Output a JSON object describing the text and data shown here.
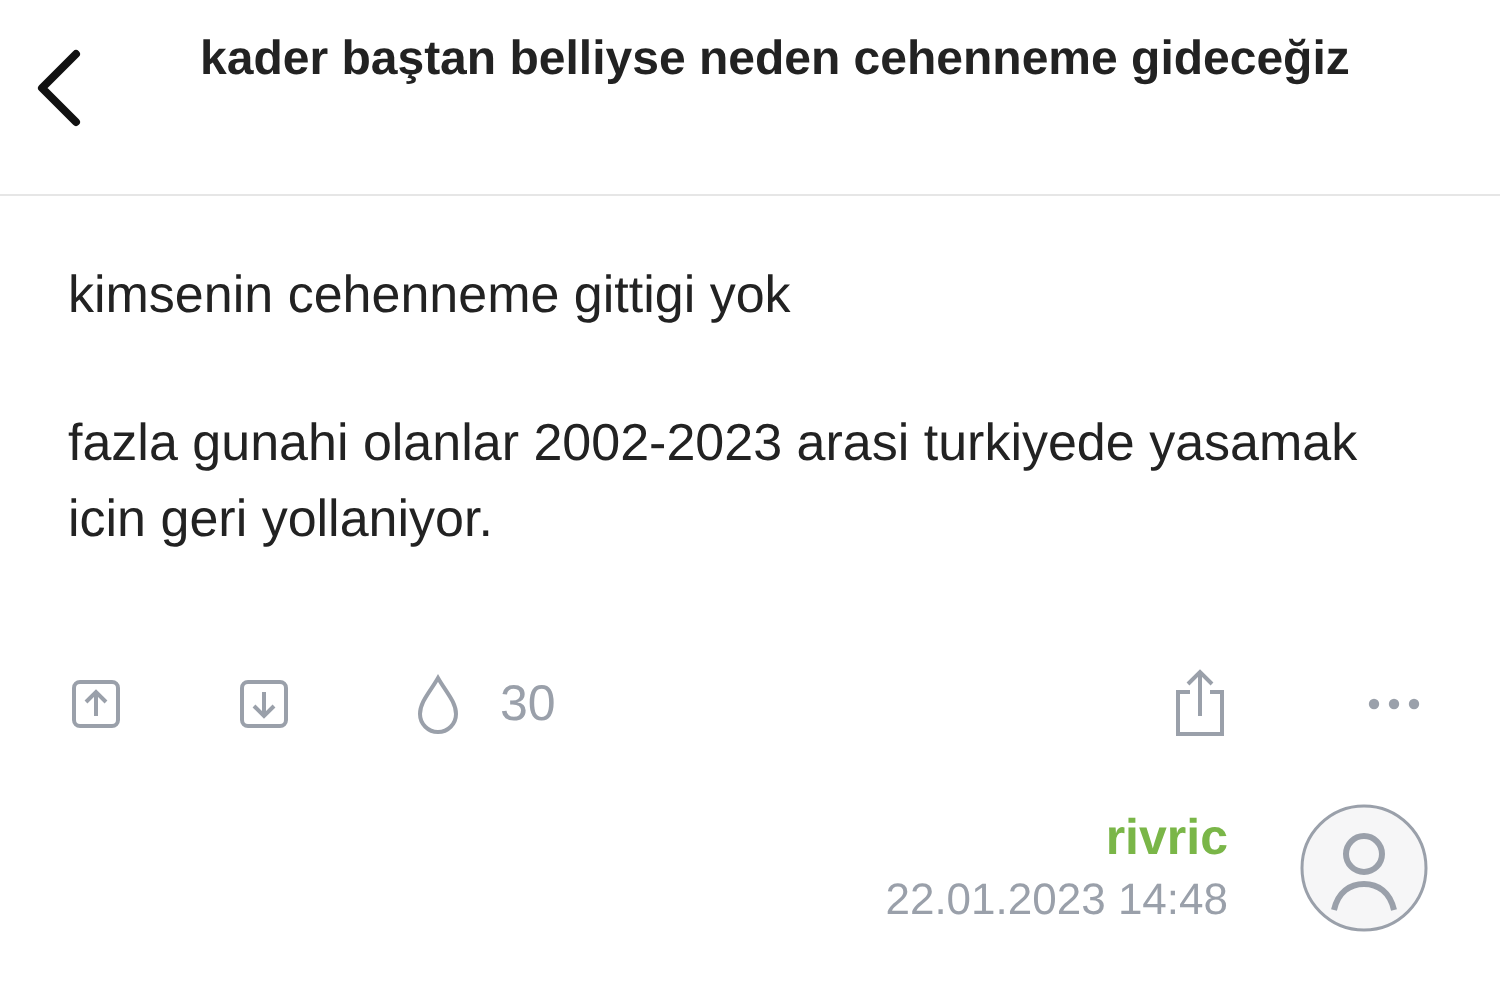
{
  "header": {
    "title": "kader baştan belliyse neden cehenneme gideceğiz"
  },
  "entry": {
    "paragraphs": [
      "kimsenin cehenneme gittigi yok",
      "fazla gunahi olanlar 2002-2023 arasi turkiyede yasamak icin geri yollaniyor."
    ]
  },
  "actions": {
    "favorite_count": "30"
  },
  "author": {
    "name": "rivric",
    "date": "22.01.2023 14:48"
  }
}
